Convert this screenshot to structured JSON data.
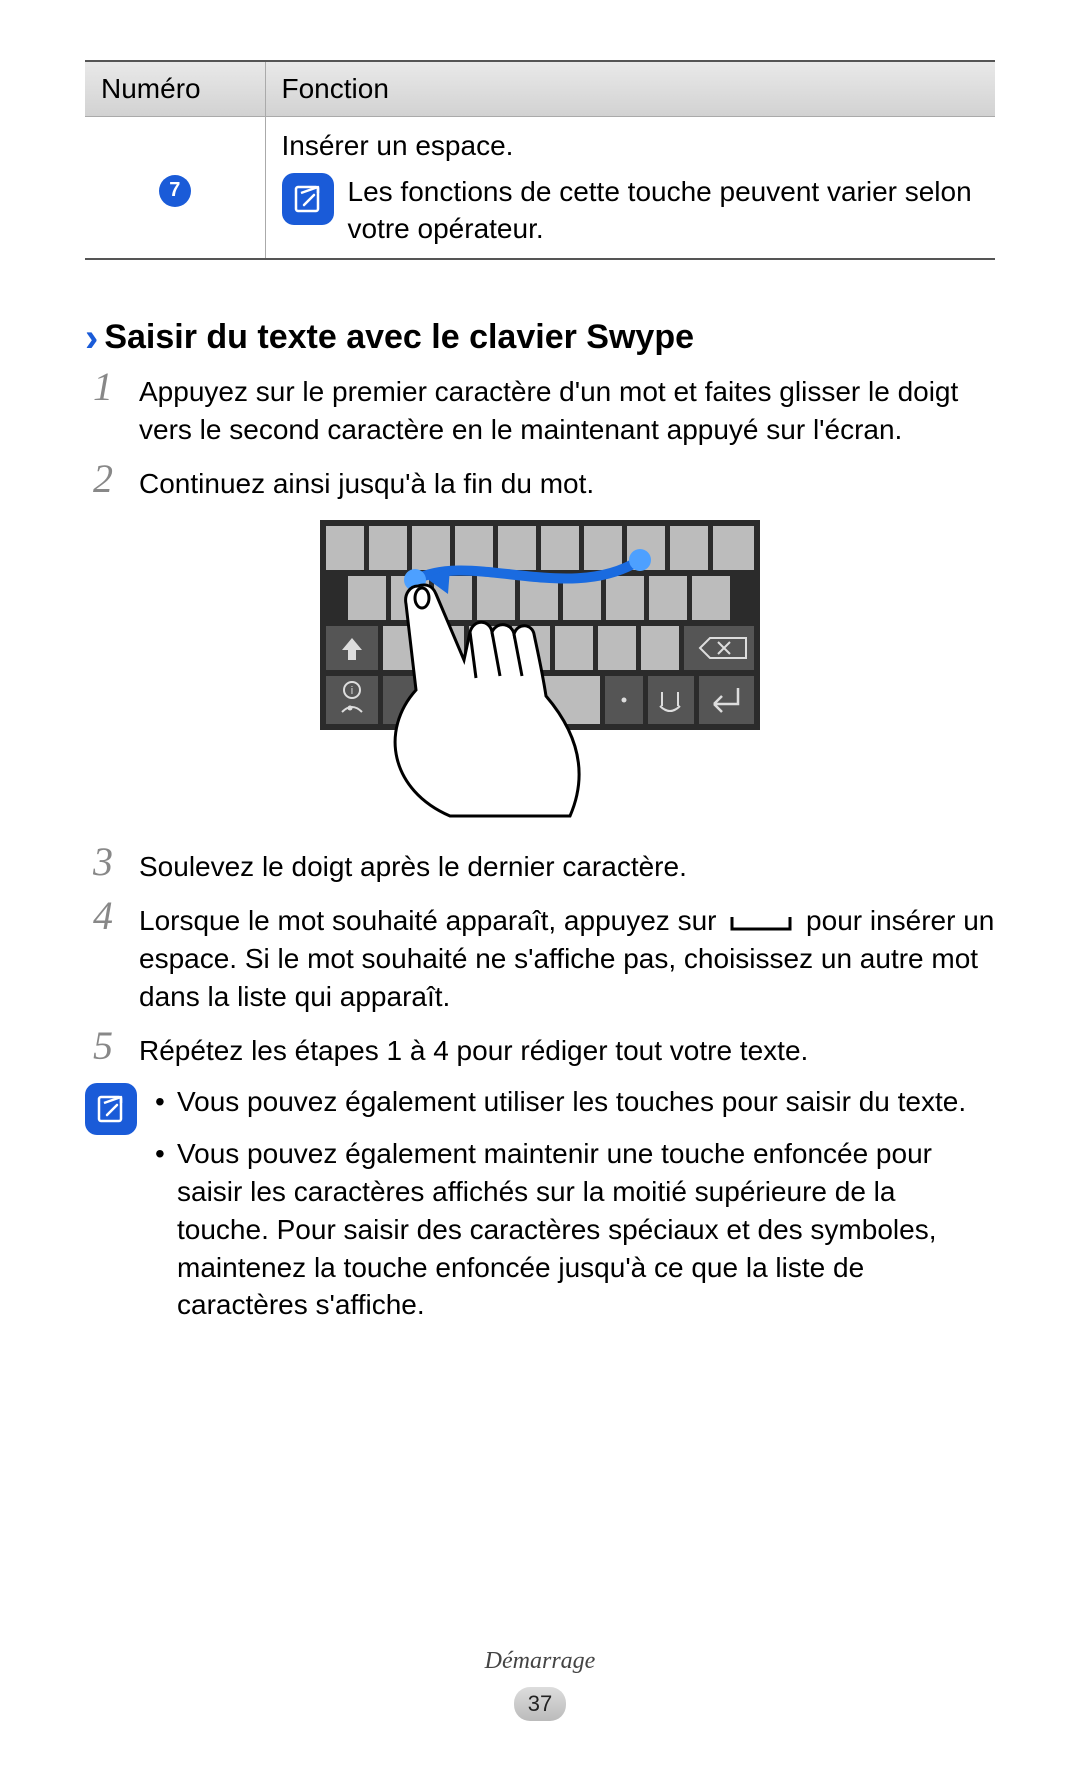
{
  "table": {
    "header_num": "Numéro",
    "header_func": "Fonction",
    "row": {
      "num": "7",
      "line1": "Insérer un espace.",
      "note": "Les fonctions de cette touche peuvent varier selon votre opérateur."
    }
  },
  "section": {
    "chevron": "›",
    "title": "Saisir du texte avec le clavier Swype"
  },
  "steps": {
    "s1n": "1",
    "s1": "Appuyez sur le premier caractère d'un mot et faites glisser le doigt vers le second caractère en le maintenant appuyé sur l'écran.",
    "s2n": "2",
    "s2": "Continuez ainsi jusqu'à la fin du mot.",
    "s3n": "3",
    "s3": "Soulevez le doigt après le dernier caractère.",
    "s4n": "4",
    "s4a": "Lorsque le mot souhaité apparaît, appuyez sur",
    "s4b": "pour insérer un espace. Si le mot souhaité ne s'affiche pas, choisissez un autre mot dans la liste qui apparaît.",
    "s5n": "5",
    "s5": "Répétez les étapes 1 à 4 pour rédiger tout votre texte."
  },
  "tips": {
    "t1": "Vous pouvez également utiliser les touches pour saisir du texte.",
    "t2": "Vous pouvez également maintenir une touche enfoncée pour saisir les caractères affichés sur la moitié supérieure de la touche. Pour saisir des caractères spéciaux et des symboles, maintenez la touche enfoncée jusqu'à ce que la liste de caractères s'affiche."
  },
  "footer": {
    "section": "Démarrage",
    "page": "37"
  }
}
